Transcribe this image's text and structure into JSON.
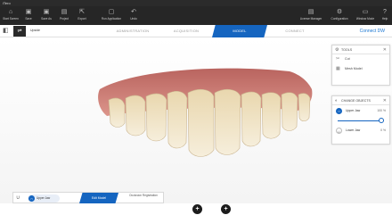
{
  "window": {
    "title": "iTero"
  },
  "toolbar": {
    "buttons": [
      {
        "label": "Start Screen",
        "icon": "home-icon"
      },
      {
        "label": "Save",
        "icon": "save-icon"
      },
      {
        "label": "Save As",
        "icon": "save-as-icon"
      },
      {
        "label": "Project",
        "icon": "project-icon"
      },
      {
        "label": "Export",
        "icon": "export-icon"
      },
      {
        "label": "Run Application",
        "icon": "run-icon"
      },
      {
        "label": "Undo",
        "icon": "undo-icon"
      },
      {
        "label": "License Manager",
        "icon": "license-icon"
      },
      {
        "label": "Configuration",
        "icon": "gear-icon"
      },
      {
        "label": "Window Mode",
        "icon": "window-icon"
      },
      {
        "label": "Help",
        "icon": "help-icon"
      }
    ]
  },
  "workflow": {
    "patient": "Upside",
    "steps": [
      "ADMINISTRATION",
      "ACQUISITION",
      "MODEL",
      "CONNECT"
    ],
    "active_step": "MODEL",
    "connect_label": "Connect DW"
  },
  "tools_panel": {
    "title": "TOOLS",
    "items": [
      {
        "label": "Cut",
        "icon": "scissors-icon"
      },
      {
        "label": "Mesh Model",
        "icon": "mesh-icon"
      }
    ]
  },
  "objects_panel": {
    "title": "CHANGE OBJECTS",
    "items": [
      {
        "label": "Upper Jaw",
        "value": "100 %",
        "active": true
      },
      {
        "label": "Lower Jaw",
        "value": "0 %",
        "active": false
      }
    ],
    "slider_fraction": 0.95
  },
  "bottombar": {
    "object_label": "Upper Jaw",
    "edit_label": "Edit Model",
    "next_label": "Occlusion Registration"
  },
  "colors": {
    "accent": "#1565c0",
    "toolbar": "#262626",
    "gum": "#d4847b",
    "tooth": "#efe3c4"
  }
}
